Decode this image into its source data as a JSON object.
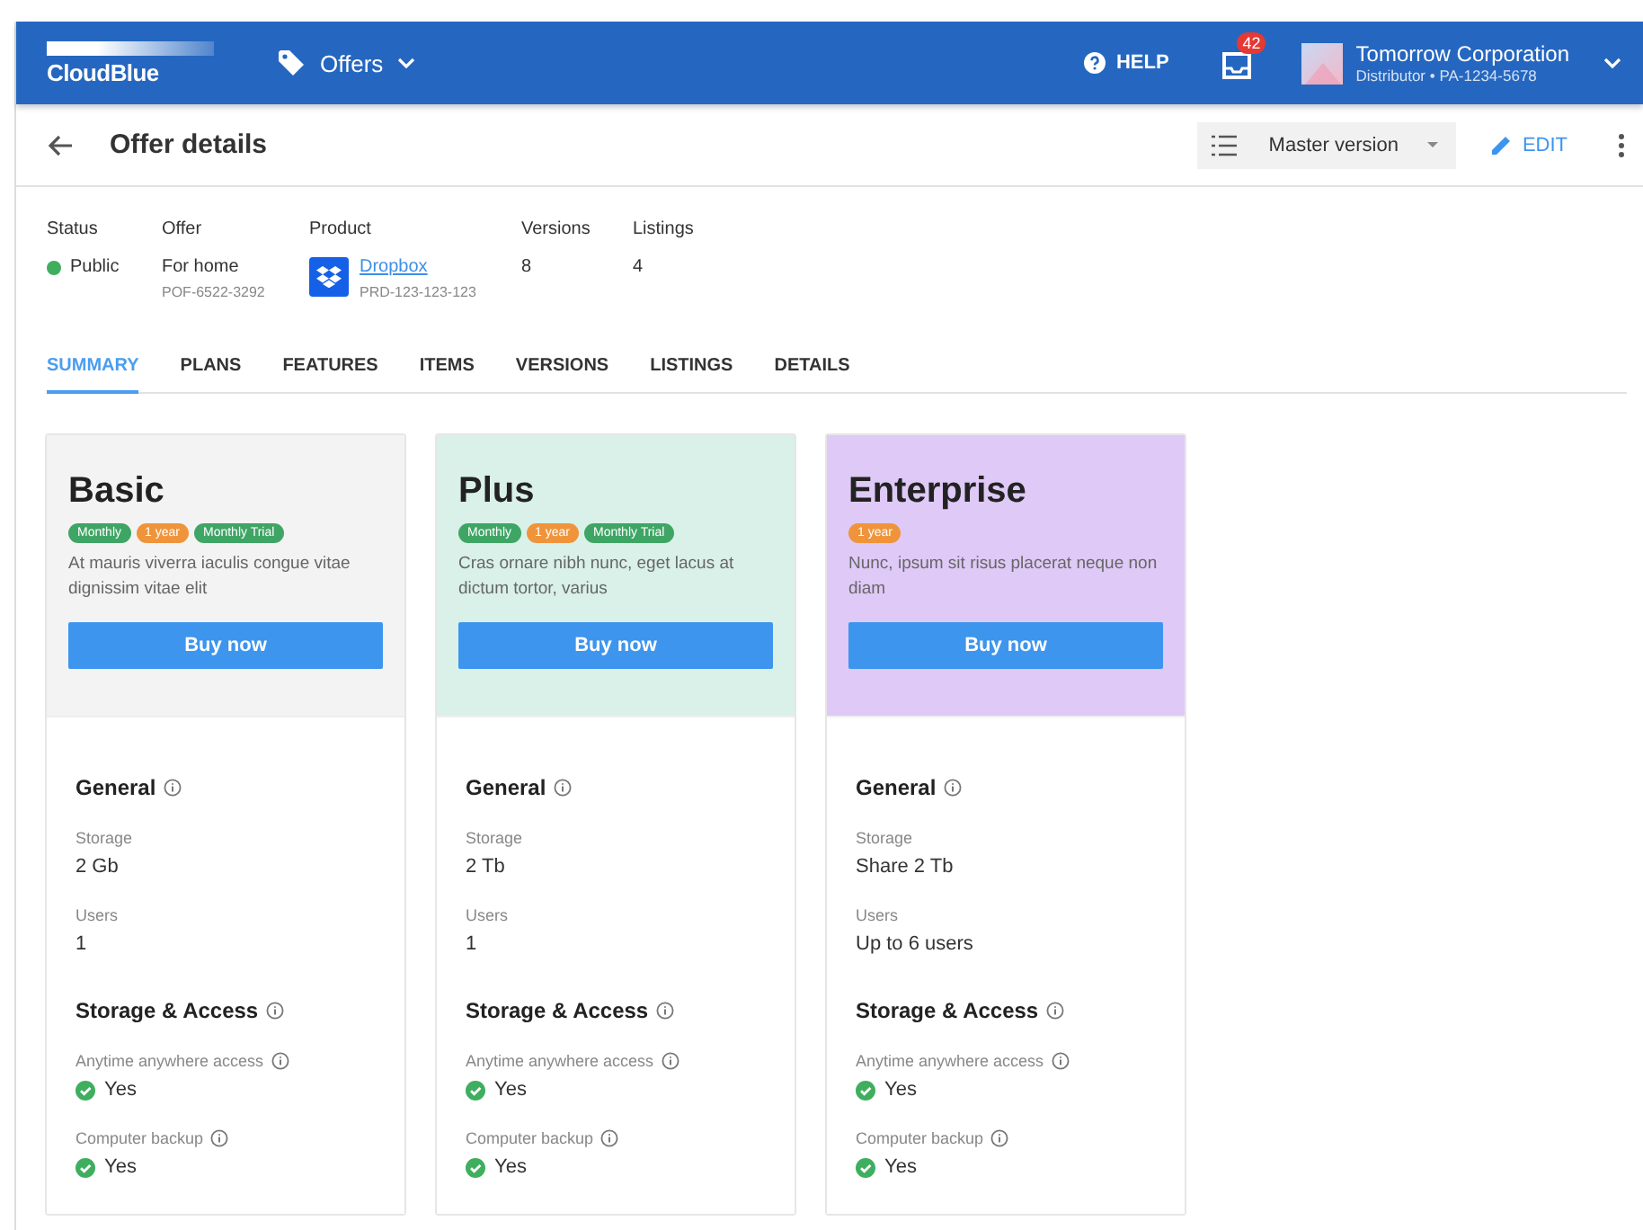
{
  "header": {
    "logo": "CloudBlue",
    "nav": {
      "label": "Offers"
    },
    "help": "HELP",
    "notifications": {
      "count": "42"
    },
    "account": {
      "name": "Tomorrow Corporation",
      "detail": "Distributor • PA-1234-5678"
    }
  },
  "toolbar": {
    "title": "Offer details",
    "version": "Master version",
    "edit": "EDIT"
  },
  "info": [
    {
      "label": "Status",
      "kind": "status",
      "value": "Public",
      "color": "#3fae5f"
    },
    {
      "label": "Offer",
      "kind": "text",
      "value": "For home",
      "sub": "POF-6522-3292"
    },
    {
      "label": "Product",
      "kind": "product",
      "value": "Dropbox",
      "sub": "PRD-123-123-123"
    },
    {
      "label": "Versions",
      "kind": "text",
      "value": "8"
    },
    {
      "label": "Listings",
      "kind": "text",
      "value": "4"
    }
  ],
  "tabs": [
    {
      "label": "SUMMARY",
      "selected": true
    },
    {
      "label": "PLANS",
      "selected": false
    },
    {
      "label": "FEATURES",
      "selected": false
    },
    {
      "label": "ITEMS",
      "selected": false
    },
    {
      "label": "VERSIONS",
      "selected": false
    },
    {
      "label": "LISTINGS",
      "selected": false
    },
    {
      "label": "DETAILS",
      "selected": false
    }
  ],
  "plans": [
    {
      "name": "Basic",
      "color": "#f3f3f3",
      "tags": [
        {
          "label": "Monthly",
          "color": "#3fa565"
        },
        {
          "label": "1 year",
          "color": "#f0943b"
        },
        {
          "label": "Monthly Trial",
          "color": "#3fa565"
        }
      ],
      "description": "At mauris viverra iaculis congue vitae dignissim vitae elit",
      "button": "Buy now",
      "sections": [
        {
          "title": "General",
          "items": [
            {
              "kind": "text",
              "label": "Storage",
              "value": "2 Gb"
            },
            {
              "kind": "text",
              "label": "Users",
              "value": "1"
            }
          ]
        },
        {
          "title": "Storage & Access",
          "items": [
            {
              "kind": "check",
              "label": "Anytime anywhere access",
              "value": "Yes"
            },
            {
              "kind": "check",
              "label": "Computer backup",
              "value": "Yes"
            }
          ]
        }
      ]
    },
    {
      "name": "Plus",
      "color": "#d9f1e8",
      "tags": [
        {
          "label": "Monthly",
          "color": "#3fa565"
        },
        {
          "label": "1 year",
          "color": "#f0943b"
        },
        {
          "label": "Monthly Trial",
          "color": "#3fa565"
        }
      ],
      "description": "Cras ornare nibh nunc, eget lacus at dictum tortor, varius",
      "button": "Buy now",
      "sections": [
        {
          "title": "General",
          "items": [
            {
              "kind": "text",
              "label": "Storage",
              "value": "2 Tb"
            },
            {
              "kind": "text",
              "label": "Users",
              "value": "1"
            }
          ]
        },
        {
          "title": "Storage & Access",
          "items": [
            {
              "kind": "check",
              "label": "Anytime anywhere access",
              "value": "Yes"
            },
            {
              "kind": "check",
              "label": "Computer backup",
              "value": "Yes"
            }
          ]
        }
      ]
    },
    {
      "name": "Enterprise",
      "color": "#dfc9f7",
      "tags": [
        {
          "label": "1 year",
          "color": "#f0943b"
        }
      ],
      "description": "Nunc, ipsum sit risus placerat neque non diam",
      "button": "Buy now",
      "sections": [
        {
          "title": "General",
          "items": [
            {
              "kind": "text",
              "label": "Storage",
              "value": "Share 2 Tb"
            },
            {
              "kind": "text",
              "label": "Users",
              "value": "Up to 6 users"
            }
          ]
        },
        {
          "title": "Storage & Access",
          "items": [
            {
              "kind": "check",
              "label": "Anytime anywhere access",
              "value": "Yes"
            },
            {
              "kind": "check",
              "label": "Computer backup",
              "value": "Yes"
            }
          ]
        }
      ]
    }
  ]
}
